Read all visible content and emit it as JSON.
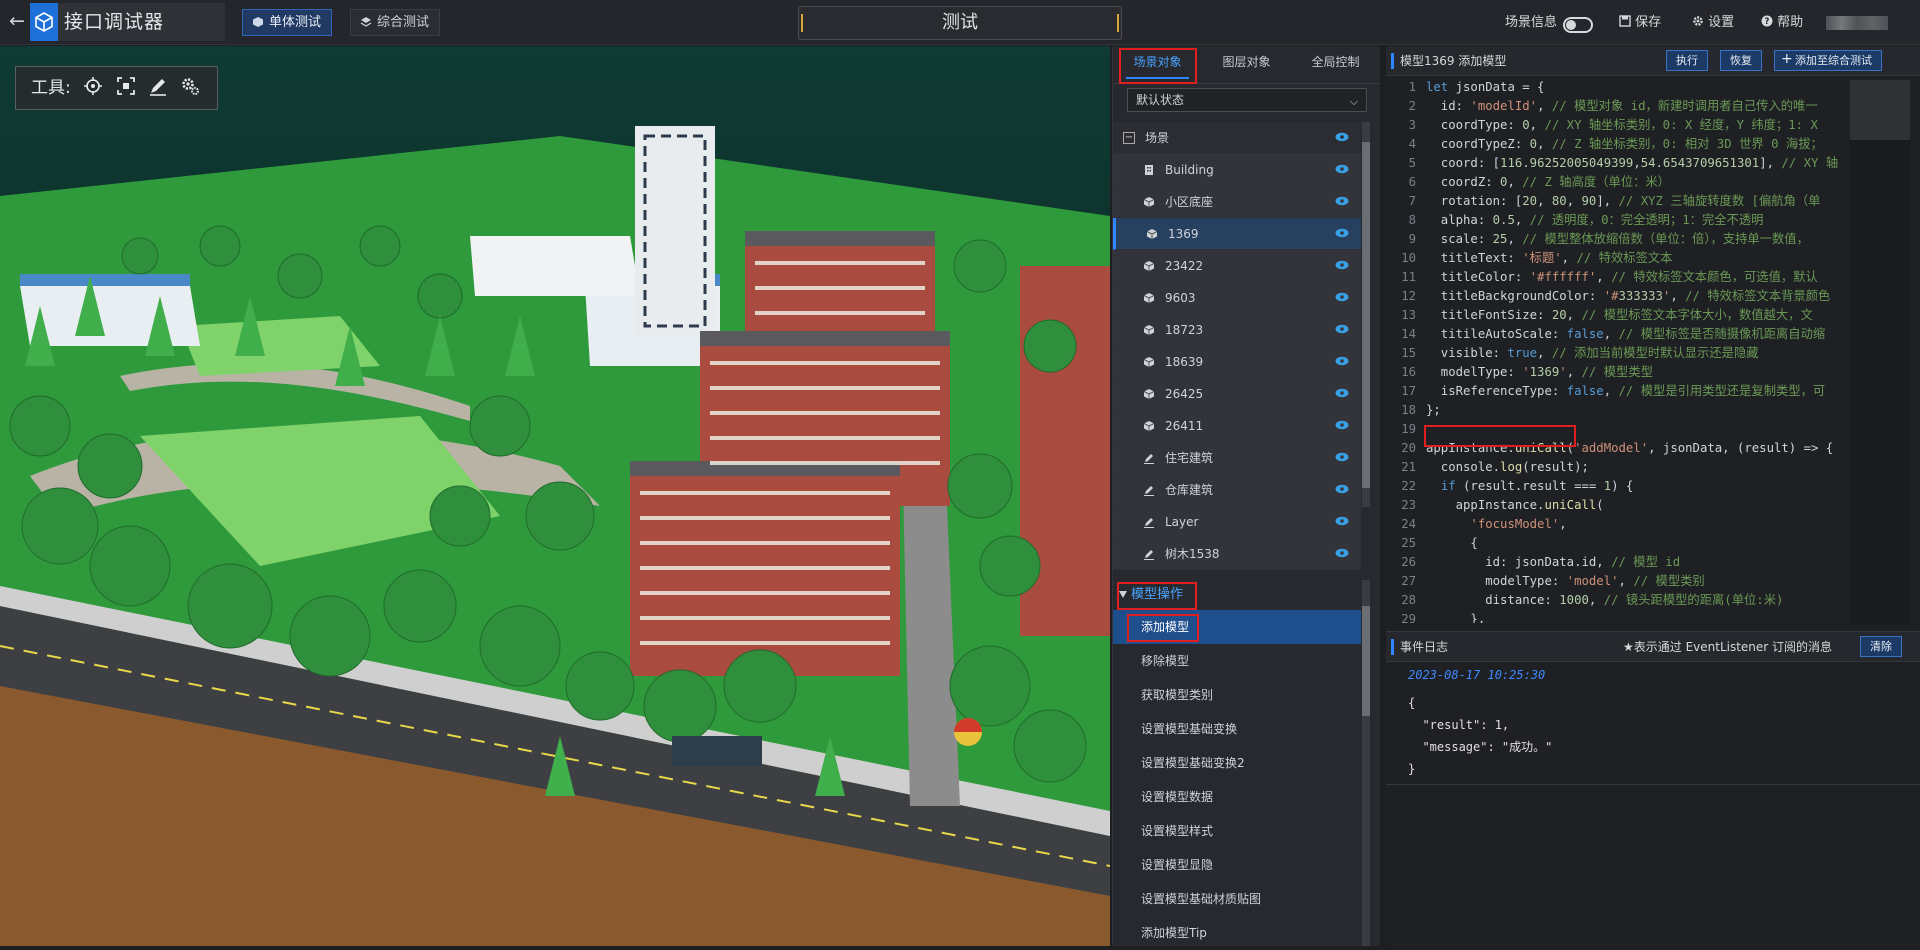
{
  "app": {
    "title": "接口调试器",
    "back_label": "←"
  },
  "modes": [
    {
      "label": "单体测试",
      "active": true
    },
    {
      "label": "综合测试",
      "active": false
    }
  ],
  "center_title": "测试",
  "topright": {
    "scene_info": "场景信息",
    "save": "保存",
    "settings": "设置",
    "help": "帮助"
  },
  "toolbox": {
    "label": "工具:"
  },
  "scene_tabs": [
    {
      "label": "场景对象",
      "active": true
    },
    {
      "label": "图层对象"
    },
    {
      "label": "全局控制"
    }
  ],
  "state_select": {
    "value": "默认状态"
  },
  "tree": {
    "root": "场景",
    "items": [
      {
        "label": "Building",
        "icon": "building-icon"
      },
      {
        "label": "小区底座",
        "icon": "cube-icon"
      },
      {
        "label": "1369",
        "icon": "cube-icon",
        "selected": true
      },
      {
        "label": "23422",
        "icon": "cube-icon"
      },
      {
        "label": "9603",
        "icon": "cube-icon"
      },
      {
        "label": "18723",
        "icon": "cube-icon"
      },
      {
        "label": "18639",
        "icon": "cube-icon"
      },
      {
        "label": "26425",
        "icon": "cube-icon"
      },
      {
        "label": "26411",
        "icon": "cube-icon"
      },
      {
        "label": "住宅建筑",
        "icon": "brush-icon"
      },
      {
        "label": "仓库建筑",
        "icon": "brush-icon"
      },
      {
        "label": "Layer",
        "icon": "brush-icon"
      },
      {
        "label": "树木1538",
        "icon": "brush-icon"
      }
    ]
  },
  "ops": {
    "header": "模型操作",
    "items": [
      "添加模型",
      "移除模型",
      "获取模型类别",
      "设置模型基础变换",
      "设置模型基础变换2",
      "设置模型数据",
      "设置模型样式",
      "设置模型显隐",
      "设置模型基础材质贴图",
      "添加模型Tip"
    ]
  },
  "code_panel": {
    "title": "模型1369 添加模型",
    "run": "执行",
    "restore": "恢复",
    "add_to_suite": "添加至综合测试"
  },
  "code_lines": [
    "let jsonData = {",
    "  id: 'modelId', // 模型对象 id，新建时调用者自己传入的唯一",
    "  coordType: 0, // XY 轴坐标类别，0: X 经度，Y 纬度；1: X",
    "  coordTypeZ: 0, // Z 轴坐标类别，0: 相对 3D 世界 0 海拔；",
    "  coord: [116.96252005049399,54.6543709651301], // XY 轴",
    "  coordZ: 0, // Z 轴高度（单位：米）",
    "  rotation: [20, 80, 90], // XYZ 三轴旋转度数 [偏航角（单",
    "  alpha: 0.5, // 透明度，0：完全透明；1：完全不透明",
    "  scale: 25, // 模型整体放缩倍数（单位：倍），支持单一数值，",
    "  titleText: '标题', // 特效标签文本",
    "  titleColor: '#ffffff', // 特效标签文本颜色，可选值，默认",
    "  titleBackgroundColor: '#333333', // 特效标签文本背景颜色",
    "  titleFontSize: 20, // 模型标签文本字体大小，数值越大，文",
    "  titileAutoScale: false, // 模型标签是否随摄像机距离自动缩",
    "  visible: true, // 添加当前模型时默认显示还是隐藏",
    "  modelType: '1369', // 模型类型",
    "  isReferenceType: false, // 模型是引用类型还是复制类型，可",
    "};",
    "",
    "appInstance.uniCall('addModel', jsonData, (result) => {",
    "  console.log(result);",
    "  if (result.result === 1) {",
    "    appInstance.uniCall(",
    "      'focusModel',",
    "      {",
    "        id: jsonData.id, // 模型 id",
    "        modelType: 'model', // 模型类别",
    "        distance: 1000, // 镜头距模型的距离(单位:米)",
    "      },"
  ],
  "event_log": {
    "title": "事件日志",
    "note": "★表示通过 EventListener 订阅的消息",
    "clear": "清除",
    "timestamp": "2023-08-17 10:25:30",
    "json_lines": [
      "{",
      "  \"result\": 1,",
      "  \"message\": \"成功。\"",
      "}"
    ]
  },
  "colors": {
    "accent": "#2f86ff",
    "highlight": "#e02020"
  }
}
